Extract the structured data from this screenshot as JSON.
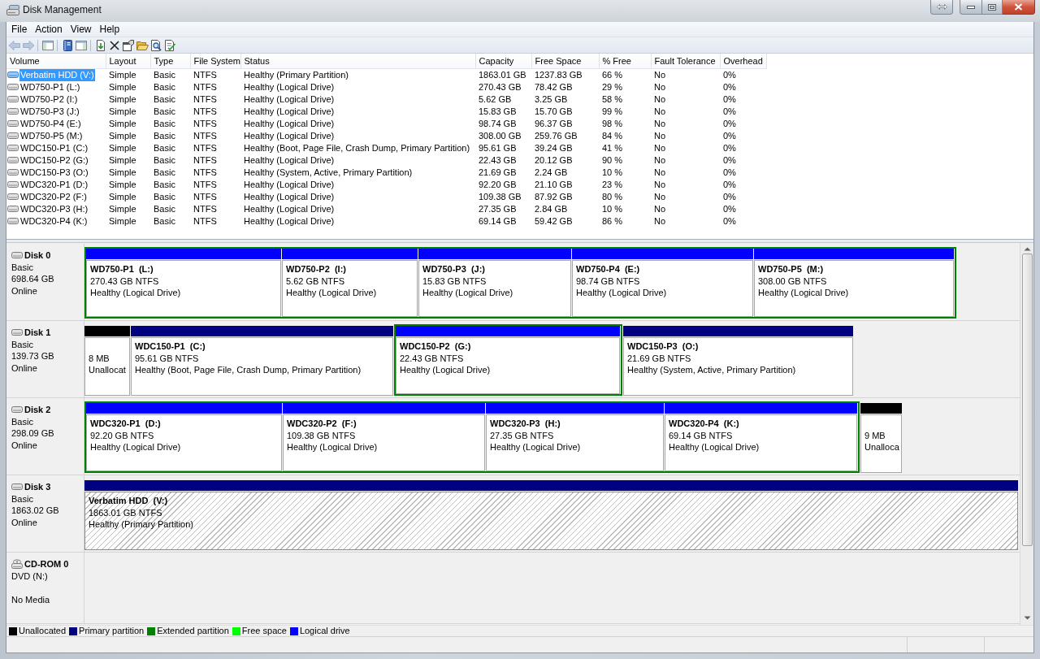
{
  "window": {
    "title": "Disk Management"
  },
  "menu": [
    "File",
    "Action",
    "View",
    "Help"
  ],
  "toolbar": [
    [
      {
        "kind": "back",
        "disabled": true
      },
      {
        "kind": "forward",
        "disabled": true
      }
    ],
    [
      {
        "kind": "console_tree",
        "disabled": false
      }
    ],
    [
      {
        "kind": "help",
        "disabled": false
      },
      {
        "kind": "action_pane",
        "disabled": false
      }
    ],
    [
      {
        "kind": "refresh",
        "disabled": false
      },
      {
        "kind": "delete",
        "disabled": false
      },
      {
        "kind": "properties",
        "disabled": false
      },
      {
        "kind": "open",
        "disabled": false
      },
      {
        "kind": "search",
        "disabled": false
      },
      {
        "kind": "rescan",
        "disabled": false
      }
    ]
  ],
  "volume_table": {
    "columns": [
      "Volume",
      "Layout",
      "Type",
      "File System",
      "Status",
      "Capacity",
      "Free Space",
      "% Free",
      "Fault Tolerance",
      "Overhead"
    ],
    "rows": [
      {
        "cells": [
          "Verbatim HDD (V:)",
          "Simple",
          "Basic",
          "NTFS",
          "Healthy (Primary Partition)",
          "1863.01 GB",
          "1237.83 GB",
          "66 %",
          "No",
          "0%"
        ],
        "selected": true
      },
      {
        "cells": [
          "WD750-P1 (L:)",
          "Simple",
          "Basic",
          "NTFS",
          "Healthy (Logical Drive)",
          "270.43 GB",
          "78.42 GB",
          "29 %",
          "No",
          "0%"
        ],
        "selected": false
      },
      {
        "cells": [
          "WD750-P2 (I:)",
          "Simple",
          "Basic",
          "NTFS",
          "Healthy (Logical Drive)",
          "5.62 GB",
          "3.25 GB",
          "58 %",
          "No",
          "0%"
        ],
        "selected": false
      },
      {
        "cells": [
          "WD750-P3 (J:)",
          "Simple",
          "Basic",
          "NTFS",
          "Healthy (Logical Drive)",
          "15.83 GB",
          "15.70 GB",
          "99 %",
          "No",
          "0%"
        ],
        "selected": false
      },
      {
        "cells": [
          "WD750-P4 (E:)",
          "Simple",
          "Basic",
          "NTFS",
          "Healthy (Logical Drive)",
          "98.74 GB",
          "96.37 GB",
          "98 %",
          "No",
          "0%"
        ],
        "selected": false
      },
      {
        "cells": [
          "WD750-P5 (M:)",
          "Simple",
          "Basic",
          "NTFS",
          "Healthy (Logical Drive)",
          "308.00 GB",
          "259.76 GB",
          "84 %",
          "No",
          "0%"
        ],
        "selected": false
      },
      {
        "cells": [
          "WDC150-P1 (C:)",
          "Simple",
          "Basic",
          "NTFS",
          "Healthy (Boot, Page File, Crash Dump, Primary Partition)",
          "95.61 GB",
          "39.24 GB",
          "41 %",
          "No",
          "0%"
        ],
        "selected": false
      },
      {
        "cells": [
          "WDC150-P2 (G:)",
          "Simple",
          "Basic",
          "NTFS",
          "Healthy (Logical Drive)",
          "22.43 GB",
          "20.12 GB",
          "90 %",
          "No",
          "0%"
        ],
        "selected": false
      },
      {
        "cells": [
          "WDC150-P3 (O:)",
          "Simple",
          "Basic",
          "NTFS",
          "Healthy (System, Active, Primary Partition)",
          "21.69 GB",
          "2.24 GB",
          "10 %",
          "No",
          "0%"
        ],
        "selected": false
      },
      {
        "cells": [
          "WDC320-P1 (D:)",
          "Simple",
          "Basic",
          "NTFS",
          "Healthy (Logical Drive)",
          "92.20 GB",
          "21.10 GB",
          "23 %",
          "No",
          "0%"
        ],
        "selected": false
      },
      {
        "cells": [
          "WDC320-P2 (F:)",
          "Simple",
          "Basic",
          "NTFS",
          "Healthy (Logical Drive)",
          "109.38 GB",
          "87.92 GB",
          "80 %",
          "No",
          "0%"
        ],
        "selected": false
      },
      {
        "cells": [
          "WDC320-P3 (H:)",
          "Simple",
          "Basic",
          "NTFS",
          "Healthy (Logical Drive)",
          "27.35 GB",
          "2.84 GB",
          "10 %",
          "No",
          "0%"
        ],
        "selected": false
      },
      {
        "cells": [
          "WDC320-P4 (K:)",
          "Simple",
          "Basic",
          "NTFS",
          "Healthy (Logical Drive)",
          "69.14 GB",
          "59.42 GB",
          "86 %",
          "No",
          "0%"
        ],
        "selected": false
      }
    ]
  },
  "disks": [
    {
      "kind": "disk",
      "name": "Disk 0",
      "type": "Basic",
      "size": "698.64 GB",
      "status": "Online",
      "segments": [
        {
          "kind": "extended",
          "children": [
            {
              "kind": "logical",
              "label": "WD750-P1  (L:)",
              "size": "270.43 GB NTFS",
              "status": "Healthy (Logical Drive)",
              "selected": false
            },
            {
              "kind": "logical",
              "label": "WD750-P2  (I:)",
              "size": "5.62 GB NTFS",
              "status": "Healthy (Logical Drive)",
              "selected": false
            },
            {
              "kind": "logical",
              "label": "WD750-P3  (J:)",
              "size": "15.83 GB NTFS",
              "status": "Healthy (Logical Drive)",
              "selected": false
            },
            {
              "kind": "logical",
              "label": "WD750-P4  (E:)",
              "size": "98.74 GB NTFS",
              "status": "Healthy (Logical Drive)",
              "selected": false
            },
            {
              "kind": "logical",
              "label": "WD750-P5  (M:)",
              "size": "308.00 GB NTFS",
              "status": "Healthy (Logical Drive)",
              "selected": false
            }
          ]
        }
      ]
    },
    {
      "kind": "disk",
      "name": "Disk 1",
      "type": "Basic",
      "size": "139.73 GB",
      "status": "Online",
      "segments": [
        {
          "kind": "unallocated",
          "size": "8 MB",
          "status": "Unallocat",
          "selected": false
        },
        {
          "kind": "primary",
          "label": "WDC150-P1  (C:)",
          "size": "95.61 GB NTFS",
          "status": "Healthy (Boot, Page File, Crash Dump, Primary Partition)",
          "selected": false
        },
        {
          "kind": "extended",
          "children": [
            {
              "kind": "logical",
              "label": "WDC150-P2  (G:)",
              "size": "22.43 GB NTFS",
              "status": "Healthy (Logical Drive)",
              "selected": false
            }
          ]
        },
        {
          "kind": "primary",
          "label": "WDC150-P3  (O:)",
          "size": "21.69 GB NTFS",
          "status": "Healthy (System, Active, Primary Partition)",
          "selected": false
        }
      ]
    },
    {
      "kind": "disk",
      "name": "Disk 2",
      "type": "Basic",
      "size": "298.09 GB",
      "status": "Online",
      "segments": [
        {
          "kind": "extended",
          "children": [
            {
              "kind": "logical",
              "label": "WDC320-P1  (D:)",
              "size": "92.20 GB NTFS",
              "status": "Healthy (Logical Drive)",
              "selected": false
            },
            {
              "kind": "logical",
              "label": "WDC320-P2  (F:)",
              "size": "109.38 GB NTFS",
              "status": "Healthy (Logical Drive)",
              "selected": false
            },
            {
              "kind": "logical",
              "label": "WDC320-P3  (H:)",
              "size": "27.35 GB NTFS",
              "status": "Healthy (Logical Drive)",
              "selected": false
            },
            {
              "kind": "logical",
              "label": "WDC320-P4  (K:)",
              "size": "69.14 GB NTFS",
              "status": "Healthy (Logical Drive)",
              "selected": false
            }
          ]
        },
        {
          "kind": "unallocated",
          "size": "9 MB",
          "status": "Unalloca",
          "selected": false
        }
      ]
    },
    {
      "kind": "disk",
      "name": "Disk 3",
      "type": "Basic",
      "size": "1863.02 GB",
      "status": "Online",
      "segments": [
        {
          "kind": "primary",
          "label": "Verbatim HDD  (V:)",
          "size": "1863.01 GB NTFS",
          "status": "Healthy (Primary Partition)",
          "selected": true
        }
      ]
    },
    {
      "kind": "cdrom",
      "name": "CD-ROM 0",
      "type": "DVD (N:)",
      "status": "No Media"
    }
  ],
  "legend": [
    {
      "label": "Unallocated",
      "color": "#000000"
    },
    {
      "label": "Primary partition",
      "color": "#000080"
    },
    {
      "label": "Extended partition",
      "color": "#008000"
    },
    {
      "label": "Free space",
      "color": "#00ff00"
    },
    {
      "label": "Logical drive",
      "color": "#0000ff"
    }
  ]
}
